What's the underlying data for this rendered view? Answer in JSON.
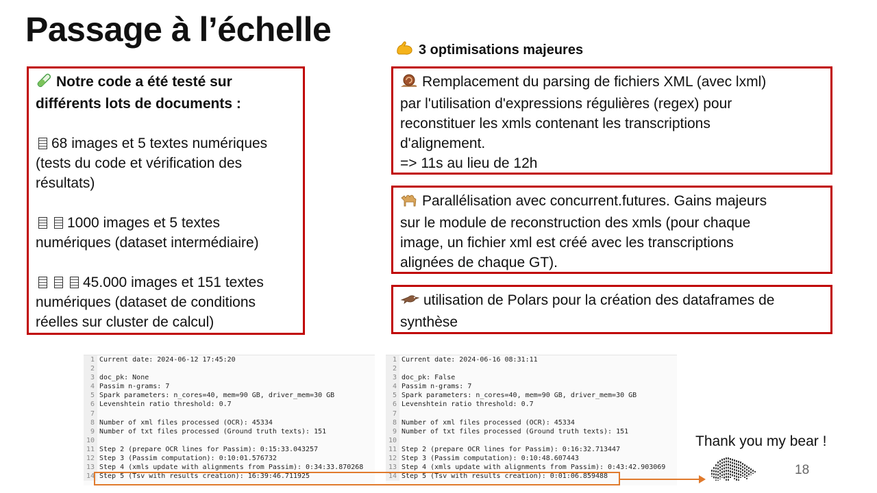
{
  "slide": {
    "title": "Passage à l’échelle",
    "subtitle": "3 optimisations majeures",
    "page_number": "18",
    "thanks": "Thank you my bear !"
  },
  "left_box": {
    "heading_line1": "Notre code a été testé sur",
    "heading_line2": "différents lots de documents :",
    "item1_line1": "68 images et 5 textes numériques",
    "item1_line2": "(tests du code et vérification des",
    "item1_line3": "résultats)",
    "item2_line1": "1000 images et 5 textes",
    "item2_line2": "numériques (dataset intermédiaire)",
    "item3_line1": "45.000 images et 151 textes",
    "item3_line2": "numériques (dataset de conditions",
    "item3_line3": "réelles sur cluster de calcul)"
  },
  "right_boxes": {
    "box1_line1": "Remplacement du parsing de fichiers XML (avec lxml)",
    "box1_line2": "par l'utilisation d'expressions régulières (regex) pour",
    "box1_line3": "reconstituer les xmls contenant les transcriptions",
    "box1_line4": "d'alignement.",
    "box1_line5": "=> 11s au lieu de 12h",
    "box2_line1": "Parallélisation avec concurrent.futures. Gains majeurs",
    "box2_line2": "sur le module de reconstruction des xmls (pour chaque",
    "box2_line3": "image, un fichier xml est créé avec les transcriptions",
    "box2_line4": "alignées de chaque GT).",
    "box3_line1": "utilisation de Polars pour la création des dataframes de",
    "box3_line2": "synthèse"
  },
  "log_left": [
    {
      "n": "1",
      "t": "Current date: 2024-06-12 17:45:20"
    },
    {
      "n": "2",
      "t": ""
    },
    {
      "n": "3",
      "t": "doc_pk: None"
    },
    {
      "n": "4",
      "t": "Passim n-grams: 7"
    },
    {
      "n": "5",
      "t": "Spark parameters: n_cores=40, mem=90 GB, driver_mem=30 GB"
    },
    {
      "n": "6",
      "t": "Levenshtein ratio threshold: 0.7"
    },
    {
      "n": "7",
      "t": ""
    },
    {
      "n": "8",
      "t": "Number of xml files processed (OCR): 45334"
    },
    {
      "n": "9",
      "t": "Number of txt files processed (Ground truth texts): 151"
    },
    {
      "n": "10",
      "t": ""
    },
    {
      "n": "11",
      "t": "Step 2 (prepare OCR lines for Passim): 0:15:33.043257"
    },
    {
      "n": "12",
      "t": "Step 3 (Passim computation): 0:10:01.576732"
    },
    {
      "n": "13",
      "t": "Step 4 (xmls update with alignments from Passim): 0:34:33.870268"
    },
    {
      "n": "14",
      "t": "Step 5 (Tsv with results creation): 16:39:46.711925"
    }
  ],
  "log_right": [
    {
      "n": "1",
      "t": "Current date: 2024-06-16 08:31:11"
    },
    {
      "n": "2",
      "t": ""
    },
    {
      "n": "3",
      "t": "doc_pk: False"
    },
    {
      "n": "4",
      "t": "Passim n-grams: 7"
    },
    {
      "n": "5",
      "t": "Spark parameters: n_cores=40, mem=90 GB, driver_mem=30 GB"
    },
    {
      "n": "6",
      "t": "Levenshtein ratio threshold: 0.7"
    },
    {
      "n": "7",
      "t": ""
    },
    {
      "n": "8",
      "t": "Number of xml files processed (OCR): 45334"
    },
    {
      "n": "9",
      "t": "Number of txt files processed (Ground truth texts): 151"
    },
    {
      "n": "10",
      "t": ""
    },
    {
      "n": "11",
      "t": "Step 2 (prepare OCR lines for Passim): 0:16:32.713447"
    },
    {
      "n": "12",
      "t": "Step 3 (Passim computation): 0:10:48.607443"
    },
    {
      "n": "13",
      "t": "Step 4 (xmls update with alignments from Passim): 0:43:42.903069"
    },
    {
      "n": "14",
      "t": "Step 5 (Tsv with results creation): 0:01:06.859488"
    }
  ],
  "colors": {
    "box_border": "#c00000",
    "highlight": "#e07a2c"
  },
  "icons": {
    "subtitle": "flexed-biceps-icon",
    "left_heading": "test-tube-icon",
    "documents": "document-icon",
    "box1": "snail-icon",
    "box2": "camel-icon",
    "box3": "bird-icon",
    "logo": "bear-logo"
  }
}
